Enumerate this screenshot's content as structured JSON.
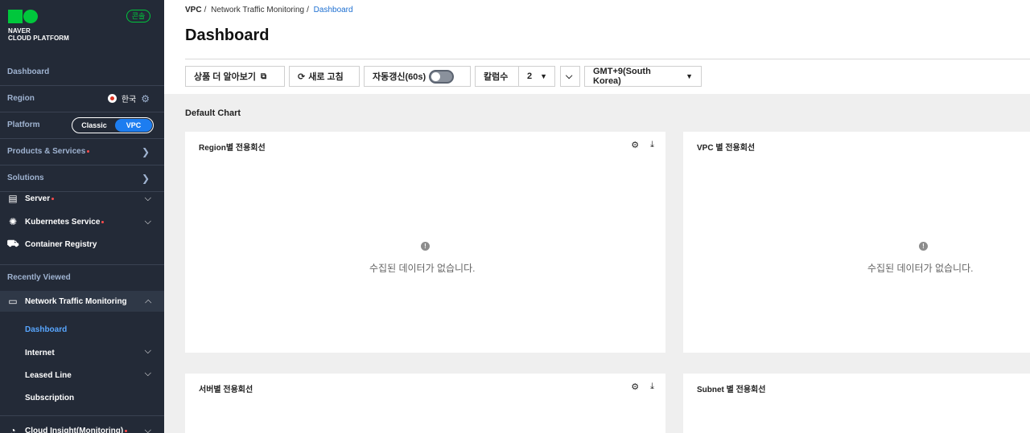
{
  "sidebar": {
    "logo_line1": "NAVER",
    "logo_line2": "CLOUD PLATFORM",
    "console_badge": "콘솔",
    "dashboard": "Dashboard",
    "region_label": "Region",
    "region_value": "한국",
    "platform_label": "Platform",
    "platform_options": [
      "Classic",
      "VPC"
    ],
    "platform_selected": "VPC",
    "products_services": "Products & Services",
    "solutions": "Solutions",
    "services": [
      {
        "label": "Server",
        "icon": "server-icon",
        "new": true
      },
      {
        "label": "Kubernetes Service",
        "icon": "kubernetes-icon",
        "new": true
      },
      {
        "label": "Container Registry",
        "icon": "container-registry-icon",
        "new": false
      }
    ],
    "recently_viewed": "Recently Viewed",
    "ntm": "Network Traffic Monitoring",
    "ntm_items": [
      "Dashboard",
      "Internet",
      "Leased Line",
      "Subscription"
    ],
    "cloud_insight": "Cloud Insight(Monitoring)"
  },
  "breadcrumb": [
    "VPC",
    "Network Traffic Monitoring",
    "Dashboard"
  ],
  "page_title": "Dashboard",
  "toolbar": {
    "learn_more": "상품 더 알아보기",
    "refresh": "새로 고침",
    "auto_refresh": "자동갱신(60s)",
    "auto_refresh_on": false,
    "columns_label": "칼럼수",
    "columns_value": "2",
    "timezone": "GMT+9(South Korea)"
  },
  "section_title": "Default Chart",
  "cards": [
    {
      "title": "Region별 전용회선",
      "empty": "수집된 데이터가 없습니다."
    },
    {
      "title": "VPC 별 전용회선",
      "empty": "수집된 데이터가 없습니다."
    },
    {
      "title": "서버별 전용회선",
      "empty": ""
    },
    {
      "title": "Subnet 별 전용회선",
      "empty": ""
    }
  ],
  "colors": {
    "sidebar_bg": "#232a37",
    "accent": "#1d7df0",
    "brand": "#00c73c",
    "active_link": "#58a6ff"
  }
}
